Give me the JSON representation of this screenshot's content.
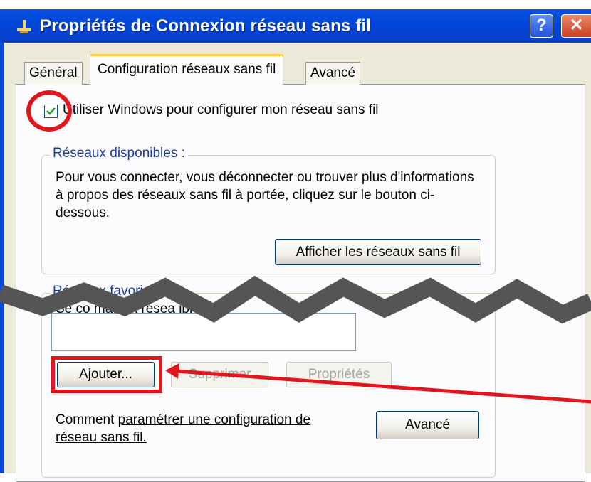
{
  "window": {
    "title": "Propriétés de Connexion réseau sans fil",
    "help_button": "?",
    "close_button": "✕"
  },
  "tabs": [
    {
      "label": "Général",
      "selected": false
    },
    {
      "label": "Configuration réseaux sans fil",
      "selected": true
    },
    {
      "label": "Avancé",
      "selected": false
    }
  ],
  "use_windows_checkbox": {
    "label": "Utiliser Windows pour configurer mon réseau sans fil",
    "checked": true
  },
  "available_networks": {
    "legend": "Réseaux disponibles :",
    "description": "Pour vous connecter, vous déconnecter ou trouver plus d'informations à propos des réseaux sans fil à portée, cliquez sur le bouton ci-dessous.",
    "show_button": "Afficher les réseaux sans fil"
  },
  "preferred_networks": {
    "legend": "Réseaux favoris :",
    "description_partial": "Se co        matio         x résea           ibles",
    "add_button": "Ajouter...",
    "remove_button": "Supprimer",
    "properties_button": "Propriétés"
  },
  "help": {
    "text_prefix": "Comment ",
    "link_text": "paramétrer une configuration de réseau sans fil.",
    "advanced_button": "Avancé"
  },
  "colors": {
    "titlebar": "#0047d9",
    "highlight": "#e3151c",
    "dialog_bg": "#ece9d8",
    "tab_accent": "#ffc83c"
  }
}
